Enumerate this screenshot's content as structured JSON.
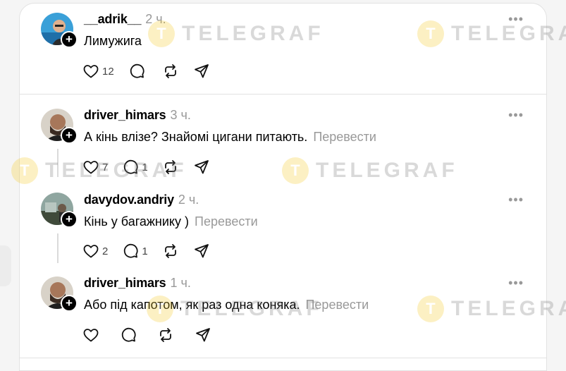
{
  "posts": [
    {
      "username": "__adrik__",
      "time": "2 ч.",
      "text": "Лимужига",
      "translate": "",
      "likes": "12",
      "replies": "",
      "avatar_color": "#2d8fc9"
    },
    {
      "username": "driver_himars",
      "time": "3 ч.",
      "text": "А кінь влізе? Знайомі цигани питають.",
      "translate": "Перевести",
      "likes": "7",
      "replies": "1",
      "avatar_color": "#4a4a4a"
    },
    {
      "username": "davydov.andriy",
      "time": "2 ч.",
      "text": "Кінь у багажнику )",
      "translate": "Перевести",
      "likes": "2",
      "replies": "1",
      "avatar_color": "#6f7f5c"
    },
    {
      "username": "driver_himars",
      "time": "1 ч.",
      "text": "Або під капотом, як раз одна коняка.",
      "translate": "Перевести",
      "likes": "",
      "replies": "",
      "avatar_color": "#4a4a4a"
    }
  ],
  "more_label": "•••",
  "plus_label": "+",
  "watermark": {
    "logo": "T",
    "text": "TELEGRAF"
  },
  "icons": {
    "like": "heart-icon",
    "reply": "comment-icon",
    "repost": "repost-icon",
    "share": "send-icon",
    "more": "more-icon",
    "follow": "plus-icon"
  }
}
